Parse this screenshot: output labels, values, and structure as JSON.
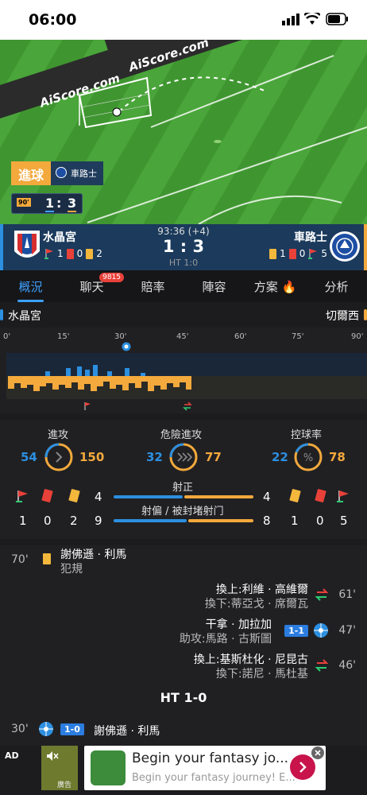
{
  "status_bar": {
    "time": "06:00"
  },
  "pitch": {
    "brand_text": "AiScore.com",
    "goal_label": "進球",
    "goal_team": "車路士",
    "mini_score_home": "1",
    "mini_score_sep": ":",
    "mini_score_away": "3",
    "mini_time": "90'"
  },
  "scoreboard": {
    "home_name": "水晶宮",
    "away_name": "車路士",
    "match_time": "93:36 (+4)",
    "score": "1 : 3",
    "ht": "HT 1:0",
    "home_stats": {
      "corners": "1",
      "red": "0",
      "yellow": "2"
    },
    "away_stats": {
      "yellow": "1",
      "red": "0",
      "corners": "5"
    }
  },
  "tabs": [
    {
      "label": "概況"
    },
    {
      "label": "聊天",
      "badge": "9815"
    },
    {
      "label": "賠率"
    },
    {
      "label": "陣容"
    },
    {
      "label": "方案 🔥"
    },
    {
      "label": "分析"
    }
  ],
  "team_row": {
    "home": "水晶宮",
    "away": "切爾西"
  },
  "timeline": {
    "ticks": [
      "0'",
      "15'",
      "30'",
      "45'",
      "60'",
      "75'",
      "90'"
    ]
  },
  "stats": {
    "attack": {
      "label": "進攻",
      "home": "54",
      "away": "150",
      "home_share": 0.26
    },
    "dangerous": {
      "label": "危險進攻",
      "home": "32",
      "away": "77",
      "home_share": 0.29
    },
    "possession": {
      "label": "控球率",
      "home": "22",
      "away": "78",
      "home_share": 0.22
    },
    "shots_on": {
      "label": "射正",
      "home": "4",
      "away": "4"
    },
    "shots_off": {
      "label": "射偏 / 被封堵射门",
      "home": "9",
      "away": "8"
    },
    "home_row": {
      "corners": "1",
      "red": "0",
      "yellow": "2"
    },
    "away_row": {
      "yellow": "1",
      "red": "0",
      "corners": "5"
    }
  },
  "events": {
    "e1": {
      "minute": "70'",
      "player": "謝佛遜 · 利馬",
      "detail": "犯規"
    },
    "e2": {
      "minute": "61'",
      "in": "換上:利維 · 高維爾",
      "out": "換下:蒂亞戈 · 席爾瓦"
    },
    "e3": {
      "minute": "47'",
      "player": "干拿 · 加拉加",
      "assist": "助攻:馬路 · 古斯圖",
      "score": "1-1"
    },
    "e4": {
      "minute": "46'",
      "in": "換上:基斯杜化 · 尼昆古",
      "out": "換下:諾尼 · 馬杜基"
    },
    "ht": "HT 1-0",
    "e5": {
      "minute": "30'",
      "score": "1-0",
      "player": "謝佛遜 · 利馬"
    }
  },
  "ad": {
    "label": "AD",
    "badge": "廣告",
    "title": "Begin your fantasy jo...",
    "subtitle": "Begin your fantasy journey! E..."
  }
}
